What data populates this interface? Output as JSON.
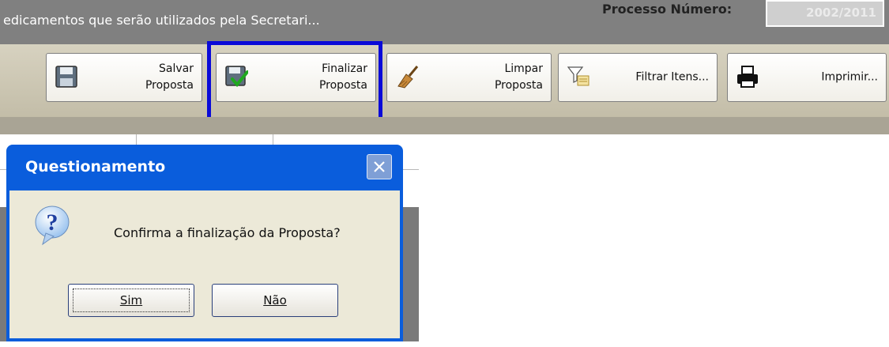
{
  "header": {
    "title": "edicamentos que serão utilizados pela Secretari...",
    "process_label": "Processo Número:",
    "process_value": "2002/2011"
  },
  "toolbar": {
    "buttons": [
      {
        "label": "Salvar\nProposta",
        "icon": "floppy-disk-icon"
      },
      {
        "label": "Finalizar\nProposta",
        "icon": "floppy-check-icon"
      },
      {
        "label": "Limpar\nProposta",
        "icon": "broom-icon"
      },
      {
        "label": "Filtrar Itens...",
        "icon": "funnel-filter-icon"
      },
      {
        "label": "Imprimir...",
        "icon": "printer-icon"
      }
    ]
  },
  "dialog": {
    "title": "Questionamento",
    "message": "Confirma a finalização da Proposta?",
    "icon": "question-icon",
    "yes_label": "Sim",
    "no_label": "Não"
  },
  "colors": {
    "highlight": "#0a0ad8",
    "dialog_titlebar": "#0a5ddc",
    "dialog_body": "#ece9d8",
    "toolbar_bg": "#d7d2c0"
  }
}
